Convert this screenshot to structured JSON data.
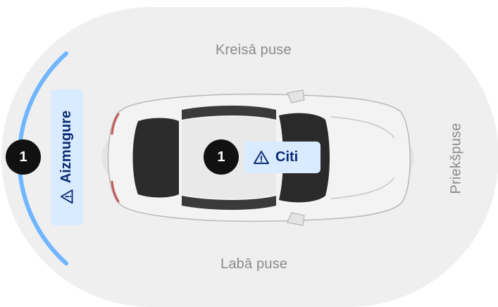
{
  "zones": {
    "left_side": "Kreisā puse",
    "right_side": "Labā puse",
    "front": "Priekšpuse"
  },
  "rear": {
    "count": "1",
    "label": "Aizmugure"
  },
  "other": {
    "count": "1",
    "label": "Citi"
  },
  "icons": {
    "warning": "warning-triangle-icon",
    "car": "car-top-view-icon"
  },
  "colors": {
    "background_zone": "#efefef",
    "rear_arc": "#6fb6ff",
    "chip_bg": "#d8ebff",
    "chip_text": "#0b2a73",
    "badge_bg": "#111111"
  }
}
